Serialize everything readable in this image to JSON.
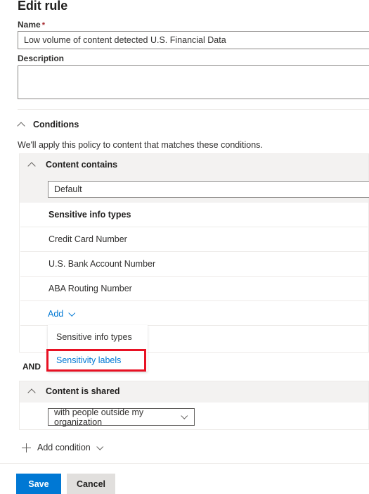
{
  "page": {
    "title": "Edit rule"
  },
  "form": {
    "name": {
      "label": "Name",
      "required_marker": "*",
      "value": "Low volume of content detected U.S. Financial Data",
      "placeholder": ""
    },
    "description": {
      "label": "Description",
      "value": "",
      "placeholder": ""
    }
  },
  "conditions": {
    "header": "Conditions",
    "helper_text": "We'll apply this policy to content that matches these conditions.",
    "groups": [
      {
        "title": "Content contains",
        "group_name_field": {
          "value": "Default",
          "placeholder": ""
        },
        "list_header": "Sensitive info types",
        "items": [
          "Credit Card Number",
          "U.S. Bank Account Number",
          "ABA Routing Number"
        ],
        "add_link": "Add",
        "add_menu": {
          "open": true,
          "items": [
            {
              "label": "Sensitive info types",
              "highlighted": false
            },
            {
              "label": "Sensitivity labels",
              "highlighted": true
            }
          ]
        }
      },
      {
        "title": "Content is shared",
        "select": {
          "value": "with people outside my organization"
        }
      }
    ],
    "operator": "AND",
    "add_condition": "Add condition"
  },
  "footer": {
    "save_label": "Save",
    "cancel_label": "Cancel"
  },
  "colors": {
    "accent": "#0078d4",
    "highlight_border": "#e81123",
    "required_star": "#a4262c",
    "band": "#f3f2f1",
    "card_border": "#edebe9"
  }
}
